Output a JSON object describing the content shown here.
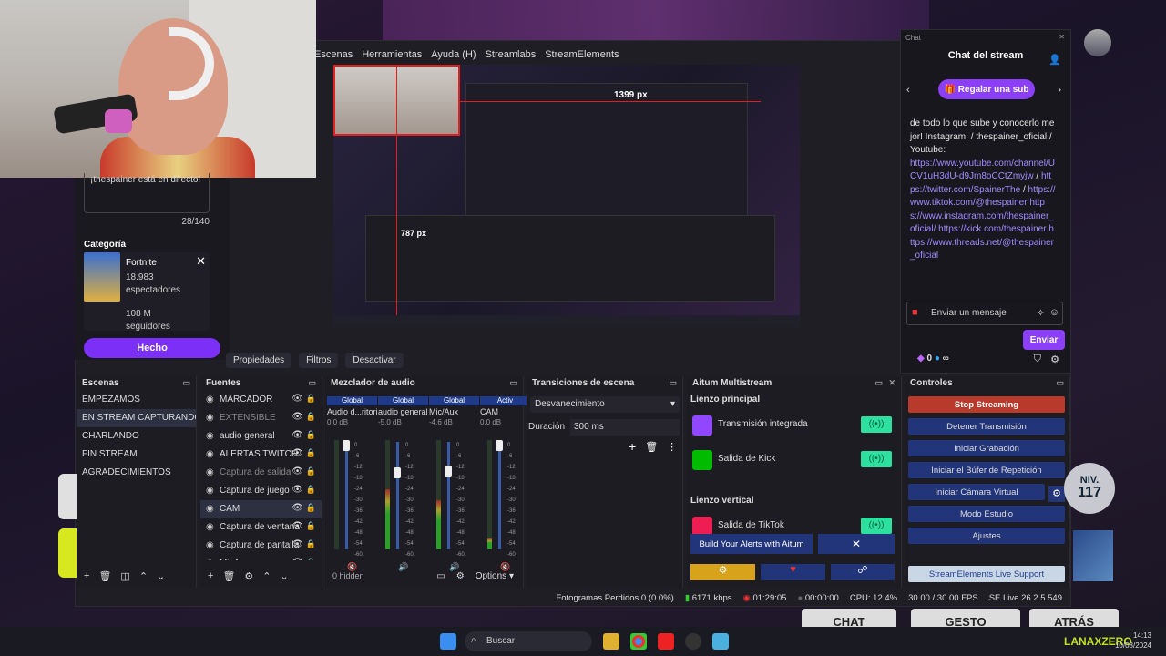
{
  "menu": [
    "Escenas",
    "Herramientas",
    "Ayuda (H)",
    "Streamlabs",
    "StreamElements"
  ],
  "preview": {
    "px_width": "1399 px",
    "px_height": "787 px"
  },
  "stream_info": {
    "title_text": "¡thespainer está en directo!",
    "char_count": "28/140",
    "category_label": "Categoría",
    "category_name": "Fortnite",
    "viewers": "18.983",
    "viewers_label": "espectadores",
    "followers": "108 M",
    "followers_label": "seguidores",
    "done_button": "Hecho"
  },
  "source_toolbar": [
    "Propiedades",
    "Filtros",
    "Desactivar"
  ],
  "scenes": {
    "title": "Escenas",
    "items": [
      "EMPEZAMOS",
      "EN STREAM CAPTURANDO",
      "CHARLANDO",
      "FIN STREAM",
      "AGRADECIMIENTOS"
    ],
    "selected": 1
  },
  "sources": {
    "title": "Fuentes",
    "items": [
      {
        "name": "MARCADOR",
        "dim": false
      },
      {
        "name": "EXTENSIBLE",
        "dim": true
      },
      {
        "name": "audio general",
        "dim": false
      },
      {
        "name": "ALERTAS TWITCH",
        "dim": false
      },
      {
        "name": "Captura de salida",
        "dim": true
      },
      {
        "name": "Captura de juego",
        "dim": false
      },
      {
        "name": "CAM",
        "dim": false
      },
      {
        "name": "Captura de ventana",
        "dim": false
      },
      {
        "name": "Captura de pantalla",
        "dim": false
      },
      {
        "name": "MicAux",
        "dim": false
      }
    ]
  },
  "mixer": {
    "title": "Mezclador de audio",
    "channels": [
      {
        "tag": "Global",
        "name": "Audio d...ritorio",
        "db": "0.0 dB",
        "level": 0.0
      },
      {
        "tag": "Global",
        "name": "audio general",
        "db": "-5.0 dB",
        "level": 0.55
      },
      {
        "tag": "Global",
        "name": "Mic/Aux",
        "db": "-4.6 dB",
        "level": 0.45
      },
      {
        "tag": "Activ",
        "name": "CAM",
        "db": "0.0 dB",
        "level": 0.1
      }
    ],
    "scale": [
      "0",
      "-6",
      "-12",
      "-18",
      "-24",
      "-30",
      "-36",
      "-42",
      "-48",
      "-54",
      "-60"
    ],
    "hidden": "0 hidden",
    "options": "Options"
  },
  "transitions": {
    "title": "Transiciones de escena",
    "selected": "Desvanecimiento",
    "duration_label": "Duración",
    "duration": "300 ms"
  },
  "aitum": {
    "title": "Aitum Multistream",
    "main_label": "Lienzo principal",
    "main": [
      {
        "name": "Transmisión integrada",
        "color": "#9146ff"
      },
      {
        "name": "Salida de Kick",
        "color": "#0b0"
      }
    ],
    "vertical_label": "Lienzo vertical",
    "vertical": [
      {
        "name": "Salida de TikTok",
        "color": "#ee1d52"
      }
    ],
    "alerts": "Build Your Alerts with Aitum"
  },
  "controls": {
    "title": "Controles",
    "buttons": [
      "Stop Streaming",
      "Detener Transmisión",
      "Iniciar Grabación",
      "Iniciar el Búfer de Repetición",
      "Iniciar Cámara Virtual",
      "Modo Estudio",
      "Ajustes"
    ],
    "se_support": "StreamElements Live Support"
  },
  "status": {
    "frames": "Fotogramas Perdidos 0 (0.0%)",
    "kbps": "6171 kbps",
    "live_time": "01:29:05",
    "rec_time": "00:00:00",
    "cpu": "CPU: 12.4%",
    "fps": "30.00 / 30.00 FPS",
    "version": "SE.Live 26.2.5.549"
  },
  "chat": {
    "window": "Chat",
    "title": "Chat del stream",
    "sub_button": "Regalar una sub",
    "message_text": "de todo lo que sube y conocerlo mejor! Instagram: / thespainer_oficial / Youtube:",
    "links": [
      "https://www.youtube.com/channel/UCV1uH3dU-d9Jm8oCCtZmyjw",
      "https://twitter.com/SpainerThe",
      "https://www.tiktok.com/@thespainer",
      "https://www.instagram.com/thespainer_oficial/",
      "https://kick.com/thespainer",
      "https://www.threads.net/@thespainer_oficial"
    ],
    "input_placeholder": "Enviar un mensaje",
    "send": "Enviar",
    "points": "0",
    "infinity": "∞"
  },
  "taskbar": {
    "search": "Buscar",
    "time": "14:13",
    "date": "10/08/2024"
  },
  "overlay": {
    "chat": "CHAT",
    "gesto": "GESTO",
    "atras": "ATRÁS",
    "level_label": "NIV.",
    "level": "117",
    "watermark": "LANAXZERO"
  }
}
